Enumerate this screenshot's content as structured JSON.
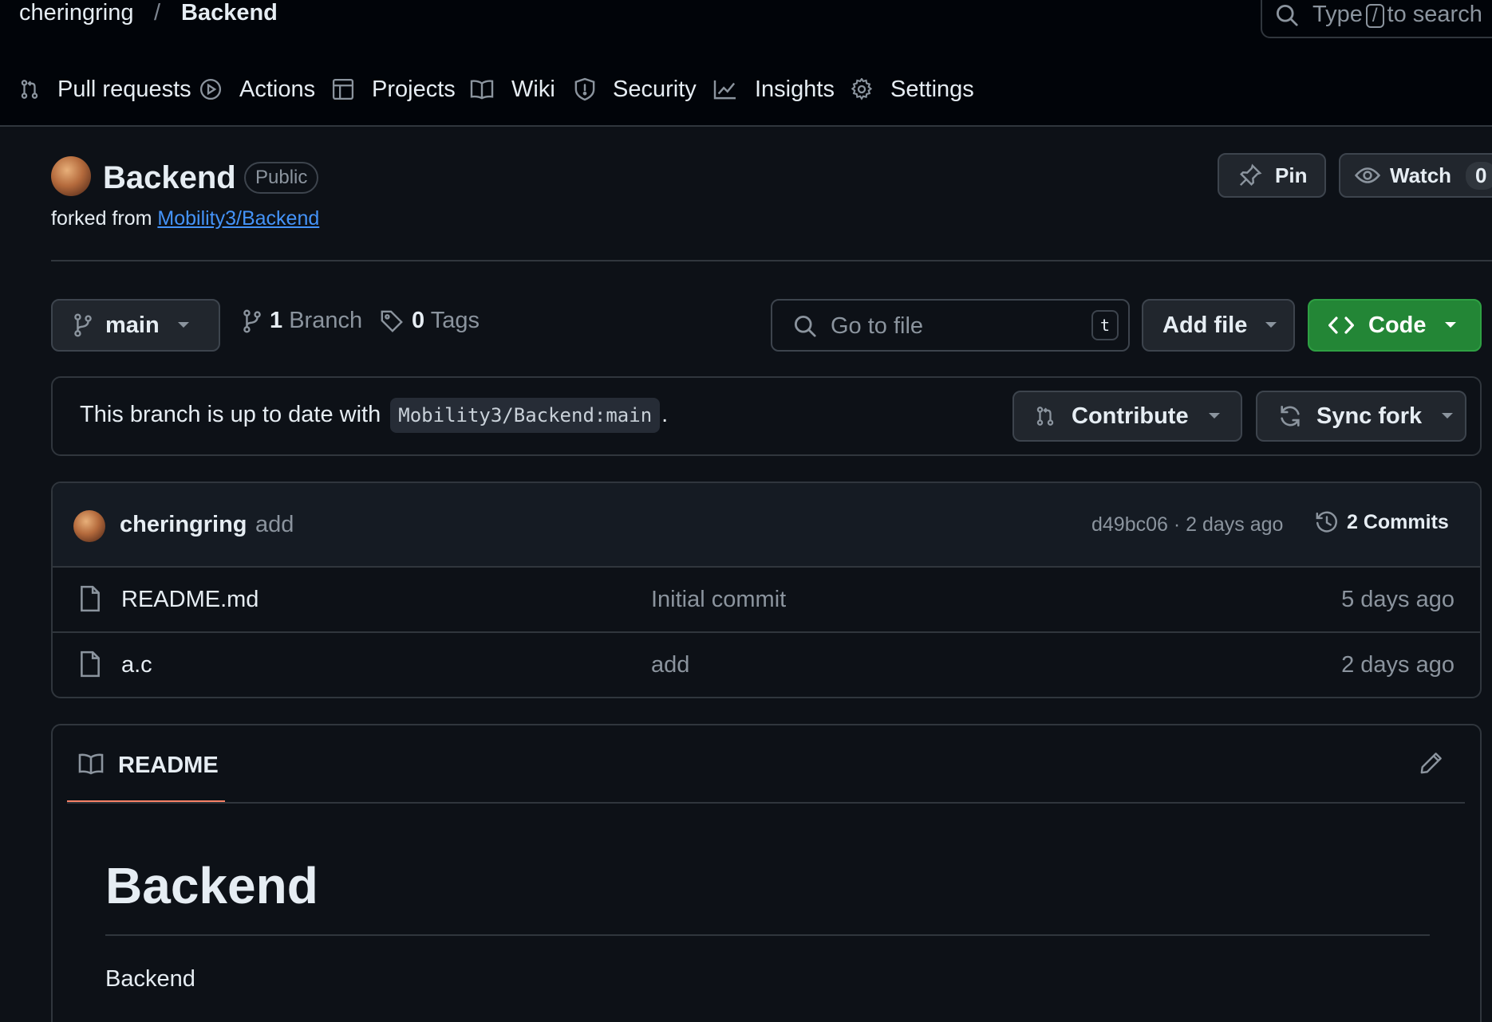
{
  "header": {
    "owner": "cheringring",
    "separator": "/",
    "repo": "Backend",
    "search": {
      "before": "Type",
      "key": "/",
      "after": "to search"
    }
  },
  "nav": {
    "pull_requests": "Pull requests",
    "actions": "Actions",
    "projects": "Projects",
    "wiki": "Wiki",
    "security": "Security",
    "insights": "Insights",
    "settings": "Settings"
  },
  "repo": {
    "name": "Backend",
    "visibility": "Public",
    "forked_prefix": "forked from",
    "forked_source": "Mobility3/Backend",
    "pin_label": "Pin",
    "watch_label": "Watch",
    "watch_count": "0"
  },
  "toolbar": {
    "branch": "main",
    "branch_count": "1",
    "branch_label": "Branch",
    "tag_count": "0",
    "tag_label": "Tags",
    "goto_placeholder": "Go to file",
    "goto_key": "t",
    "add_file": "Add file",
    "code": "Code"
  },
  "fork_status": {
    "text": "This branch is up to date with",
    "ref": "Mobility3/Backend:main",
    "period": ".",
    "contribute": "Contribute",
    "sync_fork": "Sync fork"
  },
  "latest_commit": {
    "author": "cheringring",
    "message": "add",
    "hash_time": "d49bc06 · 2 days ago",
    "commits_count": "2",
    "commits_label": "Commits"
  },
  "files": [
    {
      "name": "README.md",
      "message": "Initial commit",
      "age": "5 days ago"
    },
    {
      "name": "a.c",
      "message": "add",
      "age": "2 days ago"
    }
  ],
  "readme": {
    "tab": "README",
    "heading": "Backend",
    "body": "Backend"
  },
  "colors": {
    "accent_green": "#238636",
    "link_blue": "#4493f8",
    "tab_underline": "#f78166",
    "background": "#0d1117"
  },
  "icons": [
    "search-icon",
    "pull-request-icon",
    "actions-icon",
    "projects-icon",
    "wiki-icon",
    "shield-icon",
    "graph-icon",
    "gear-icon",
    "pin-icon",
    "eye-icon",
    "branch-icon",
    "tag-icon",
    "caret-down-icon",
    "code-icon",
    "sync-icon",
    "history-icon",
    "file-icon",
    "book-icon",
    "pencil-icon"
  ]
}
